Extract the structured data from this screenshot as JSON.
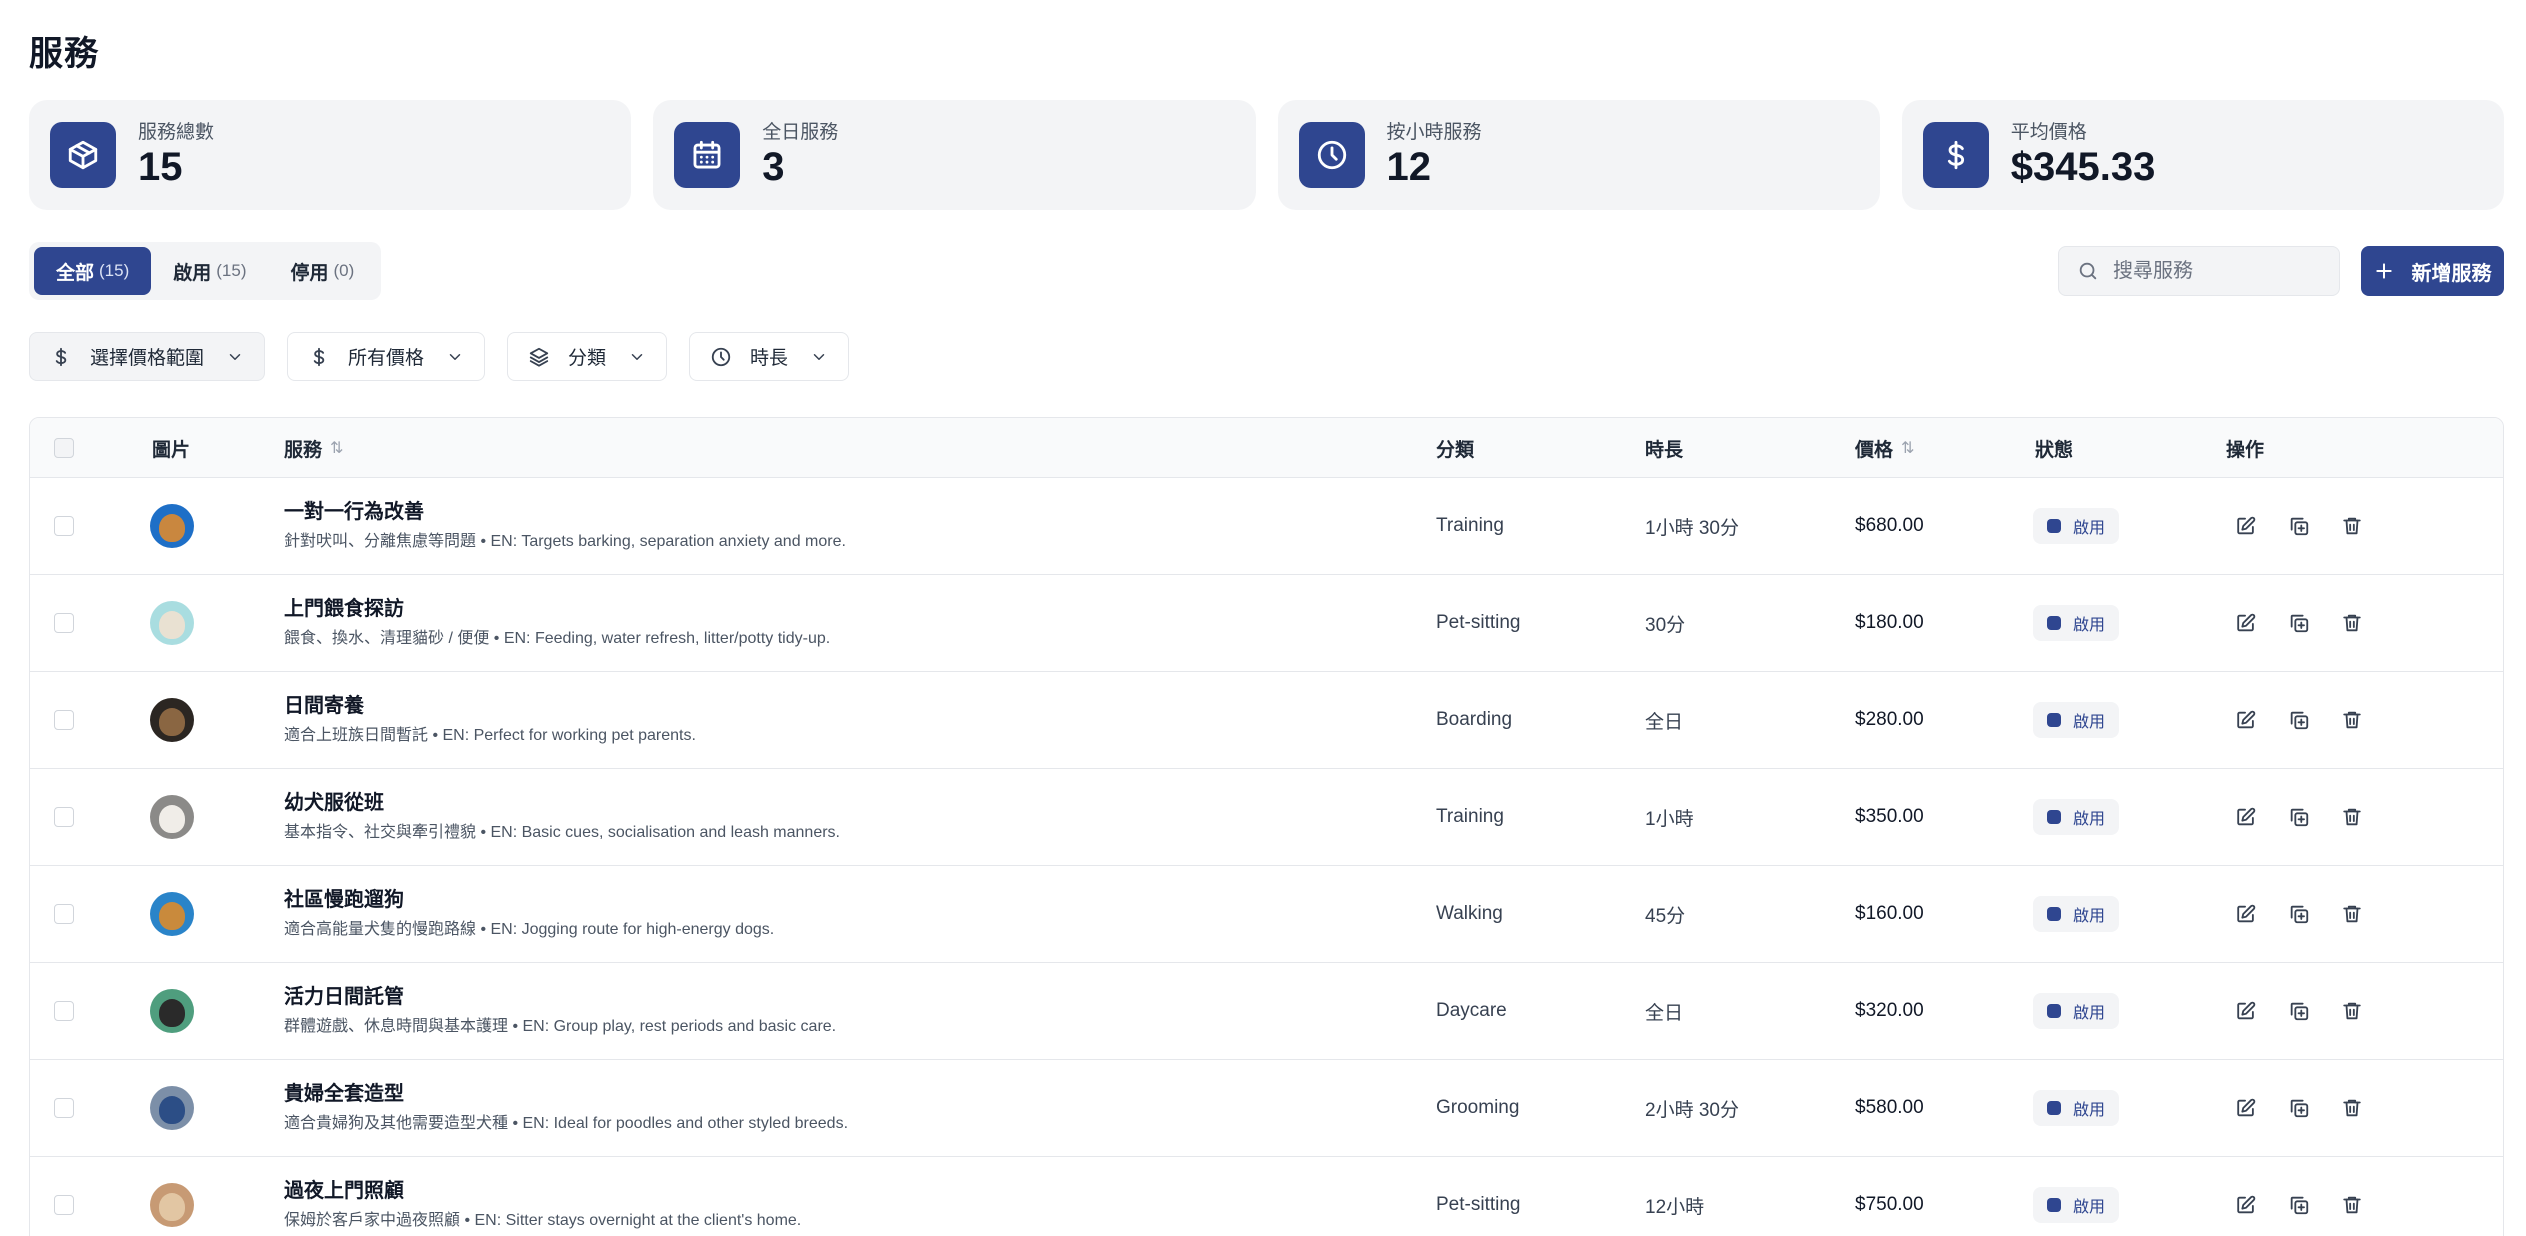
{
  "page": {
    "title": "服務"
  },
  "stats": [
    {
      "label": "服務總數",
      "value": "15",
      "icon": "box-icon"
    },
    {
      "label": "全日服務",
      "value": "3",
      "icon": "calendar-icon"
    },
    {
      "label": "按小時服務",
      "value": "12",
      "icon": "clock-icon"
    },
    {
      "label": "平均價格",
      "value": "$345.33",
      "icon": "dollar-icon"
    }
  ],
  "tabs": [
    {
      "label": "全部",
      "count": "(15)",
      "active": true
    },
    {
      "label": "啟用",
      "count": "(15)",
      "active": false
    },
    {
      "label": "停用",
      "count": "(0)",
      "active": false
    }
  ],
  "search": {
    "placeholder": "搜尋服務",
    "value": ""
  },
  "add_button": {
    "label": "新增服務"
  },
  "filters": [
    {
      "label": "選擇價格範圍",
      "icon": "dollar-icon"
    },
    {
      "label": "所有價格",
      "icon": "dollar-icon"
    },
    {
      "label": "分類",
      "icon": "layers-icon"
    },
    {
      "label": "時長",
      "icon": "clock-icon"
    }
  ],
  "table": {
    "columns": {
      "image": "圖片",
      "service": "服務",
      "category": "分類",
      "duration": "時長",
      "price": "價格",
      "status": "狀態",
      "actions": "操作"
    },
    "sort_glyph": "⇅",
    "rows": [
      {
        "name": "一對一行為改善",
        "desc": "針對吠叫、分離焦慮等問題 • EN: Targets barking, separation anxiety and more.",
        "category": "Training",
        "duration": "1小時 30分",
        "price": "$680.00",
        "status": "啟用"
      },
      {
        "name": "上門餵食探訪",
        "desc": "餵食、換水、清理貓砂 / 便便 • EN: Feeding, water refresh, litter/potty tidy-up.",
        "category": "Pet-sitting",
        "duration": "30分",
        "price": "$180.00",
        "status": "啟用"
      },
      {
        "name": "日間寄養",
        "desc": "適合上班族日間暫託 • EN: Perfect for working pet parents.",
        "category": "Boarding",
        "duration": "全日",
        "price": "$280.00",
        "status": "啟用"
      },
      {
        "name": "幼犬服從班",
        "desc": "基本指令、社交與牽引禮貌 • EN: Basic cues, socialisation and leash manners.",
        "category": "Training",
        "duration": "1小時",
        "price": "$350.00",
        "status": "啟用"
      },
      {
        "name": "社區慢跑遛狗",
        "desc": "適合高能量犬隻的慢跑路線 • EN: Jogging route for high-energy dogs.",
        "category": "Walking",
        "duration": "45分",
        "price": "$160.00",
        "status": "啟用"
      },
      {
        "name": "活力日間託管",
        "desc": "群體遊戲、休息時間與基本護理 • EN: Group play, rest periods and basic care.",
        "category": "Daycare",
        "duration": "全日",
        "price": "$320.00",
        "status": "啟用"
      },
      {
        "name": "貴婦全套造型",
        "desc": "適合貴婦狗及其他需要造型犬種 • EN: Ideal for poodles and other styled breeds.",
        "category": "Grooming",
        "duration": "2小時 30分",
        "price": "$580.00",
        "status": "啟用"
      },
      {
        "name": "過夜上門照顧",
        "desc": "保姆於客戶家中過夜照顧 • EN: Sitter stays overnight at the client's home.",
        "category": "Pet-sitting",
        "duration": "12小時",
        "price": "$750.00",
        "status": "啟用"
      }
    ]
  },
  "colors": {
    "accent": "#2f4690",
    "card_bg": "#f3f4f6",
    "border": "#e5e7eb"
  }
}
